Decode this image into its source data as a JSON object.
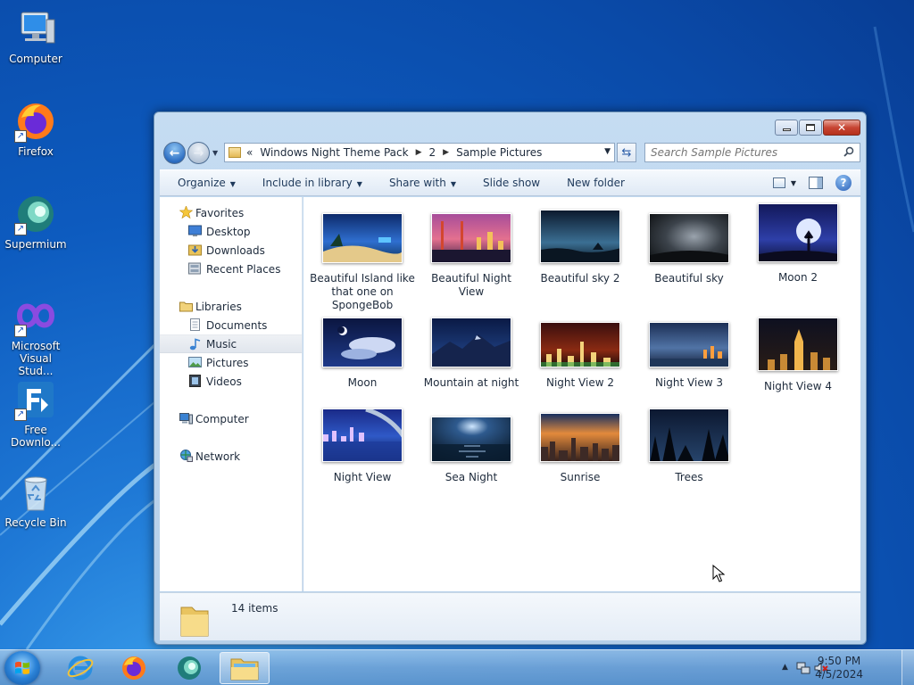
{
  "desktop": {
    "icons": [
      {
        "label": "Computer",
        "icon": "computer-icon"
      },
      {
        "label": "Firefox",
        "icon": "firefox-icon"
      },
      {
        "label": "Supermium",
        "icon": "supermium-icon"
      },
      {
        "label": "Microsoft Visual Stud...",
        "icon": "visual-studio-icon"
      },
      {
        "label": "Free Downlo...",
        "icon": "free-download-manager-icon"
      },
      {
        "label": "Recycle Bin",
        "icon": "recycle-bin-icon"
      }
    ]
  },
  "explorer": {
    "breadcrumb": {
      "overflow": "«",
      "segments": [
        "Windows Night Theme Pack",
        "2",
        "Sample Pictures"
      ]
    },
    "search": {
      "placeholder": "Search Sample Pictures"
    },
    "toolbar": {
      "organize": "Organize",
      "include_in_library": "Include in library",
      "share_with": "Share with",
      "slide_show": "Slide show",
      "new_folder": "New folder"
    },
    "nav": {
      "favorites": "Favorites",
      "desktop": "Desktop",
      "downloads": "Downloads",
      "recent_places": "Recent Places",
      "libraries": "Libraries",
      "documents": "Documents",
      "music": "Music",
      "pictures": "Pictures",
      "videos": "Videos",
      "computer": "Computer",
      "network": "Network"
    },
    "files": [
      {
        "label": "Beautiful Island like that one on SpongeBob"
      },
      {
        "label": "Beautiful Night View"
      },
      {
        "label": "Beautiful sky 2"
      },
      {
        "label": "Beautiful sky"
      },
      {
        "label": "Moon 2"
      },
      {
        "label": "Moon"
      },
      {
        "label": "Mountain at night"
      },
      {
        "label": "Night View 2"
      },
      {
        "label": "Night View 3"
      },
      {
        "label": "Night View 4"
      },
      {
        "label": "Night View"
      },
      {
        "label": "Sea Night"
      },
      {
        "label": "Sunrise"
      },
      {
        "label": "Trees"
      }
    ],
    "details": {
      "count": "14 items"
    }
  },
  "taskbar": {
    "clock": {
      "time": "9:50 PM",
      "date": "4/5/2024"
    }
  },
  "colors": {
    "desktop_blue": "#0d5bbf",
    "window_frame": "#c5dcf2",
    "close_red": "#c74533"
  }
}
